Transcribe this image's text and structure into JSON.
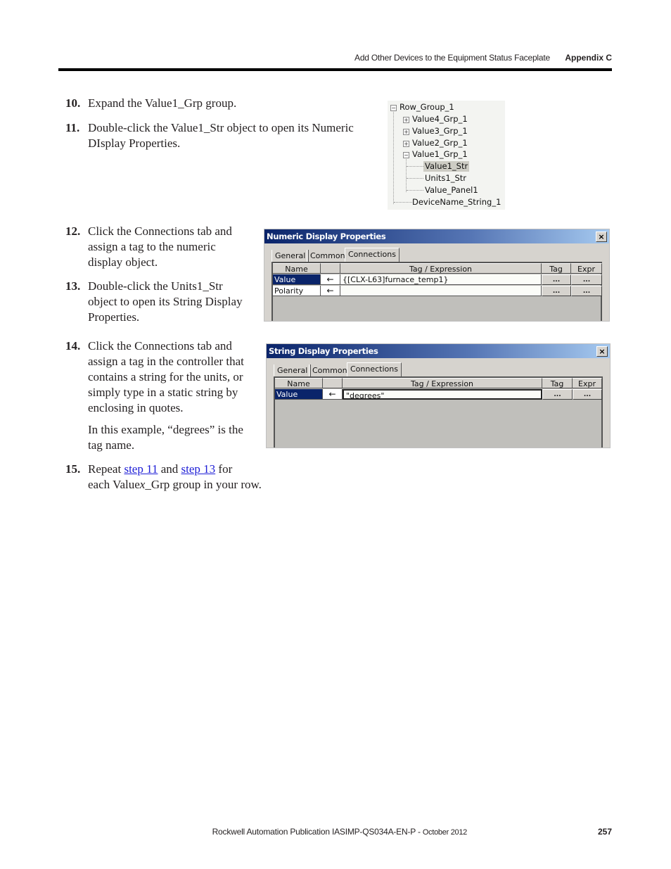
{
  "header": {
    "chapter_title": "Add Other Devices to the Equipment Status Faceplate",
    "appendix": "Appendix C"
  },
  "steps": [
    {
      "num": "10.",
      "lines": [
        "Expand the Value1_Grp group."
      ]
    },
    {
      "num": "11.",
      "lines": [
        "Double-click the Value1_Str object to open its Numeric",
        "DIsplay Properties."
      ]
    },
    {
      "num": "12.",
      "lines": [
        "Click the Connections tab and",
        "assign a tag to the numeric",
        "display object."
      ]
    },
    {
      "num": "13.",
      "lines": [
        "Double-click the Units1_Str",
        "object to open its String Display",
        "Properties."
      ]
    },
    {
      "num": "14.",
      "lines": [
        "Click the Connections tab and",
        "assign a tag in the controller that",
        "contains a string for the units, or",
        "simply type in a static string by",
        "enclosing in quotes."
      ]
    },
    {
      "num": "15.",
      "pre": "Repeat ",
      "link1": "step 11",
      "mid": " and ",
      "link2": "step 13",
      "post": " for",
      "line2_pre": "each Value",
      "line2_italic": "x",
      "line2_post": "_Grp group in your row."
    }
  ],
  "note_14": [
    "In this example, “degrees” is the",
    "tag name."
  ],
  "tree": {
    "root": "Row_Group_1",
    "items": [
      "Value4_Grp_1",
      "Value3_Grp_1",
      "Value2_Grp_1",
      "Value1_Grp_1"
    ],
    "children": [
      "Value1_Str",
      "Units1_Str",
      "Value_Panel1"
    ],
    "selected": "Value1_Str",
    "last": "DeviceName_String_1",
    "expand_glyph": "+",
    "collapse_glyph": "−"
  },
  "numeric_dialog": {
    "title": "Numeric Display Properties",
    "close": "×",
    "tabs": [
      "General",
      "Common",
      "Connections"
    ],
    "active_tab": "Connections",
    "columns": [
      "Name",
      "",
      "Tag / Expression",
      "Tag",
      "Expr"
    ],
    "rows": [
      {
        "name": "Value",
        "arrow": "←",
        "expr": "{[CLX-L63]furnace_temp1}",
        "tag_btn": "...",
        "expr_btn": "..."
      },
      {
        "name": "Polarity",
        "arrow": "←",
        "expr": "",
        "tag_btn": "...",
        "expr_btn": "..."
      }
    ]
  },
  "string_dialog": {
    "title": "String Display Properties",
    "close": "×",
    "tabs": [
      "General",
      "Common",
      "Connections"
    ],
    "active_tab": "Connections",
    "columns": [
      "Name",
      "",
      "Tag / Expression",
      "Tag",
      "Expr"
    ],
    "rows": [
      {
        "name": "Value",
        "arrow": "←",
        "expr": "\"degrees\"",
        "tag_btn": "...",
        "expr_btn": "..."
      }
    ]
  },
  "footer": {
    "publication": "Rockwell Automation Publication IASIMP-QS034A-EN-P - ",
    "date": "October 2012",
    "page": "257"
  }
}
